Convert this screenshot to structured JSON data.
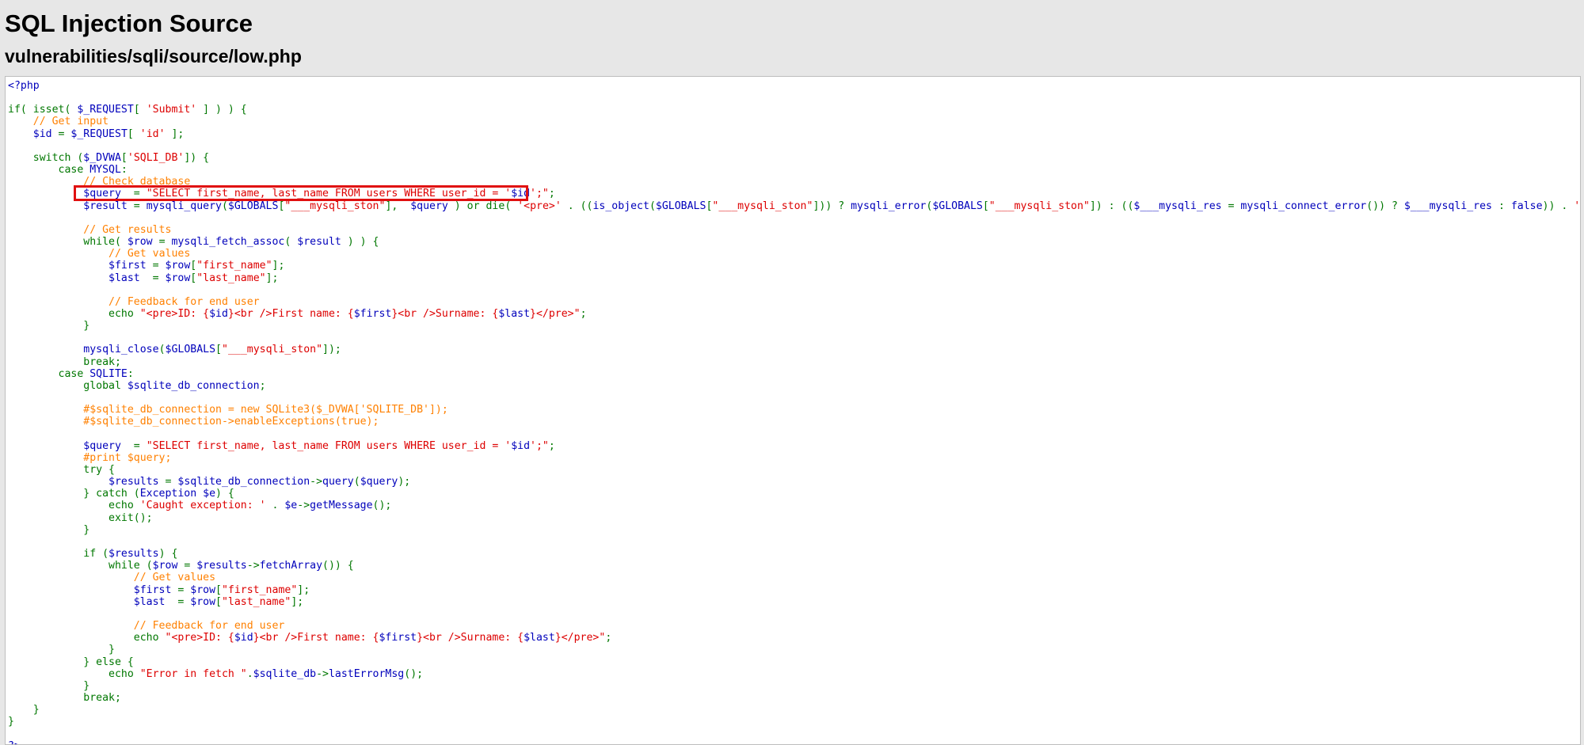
{
  "page": {
    "title": "SQL Injection Source",
    "file_path": "vulnerabilities/sqli/source/low.php"
  },
  "highlight": {
    "color": "#e01010",
    "target_line": 10
  },
  "colors": {
    "keyword": "#007700",
    "string": "#dd0000",
    "comment": "#ff8000",
    "default": "#0000bb"
  },
  "code_lines": [
    [
      [
        "v",
        "<?php"
      ]
    ],
    [],
    [
      [
        "k",
        "if( isset( "
      ],
      [
        "v",
        "$_REQUEST"
      ],
      [
        "k",
        "[ "
      ],
      [
        "s",
        "'Submit'"
      ],
      [
        "k",
        " ] ) ) {"
      ]
    ],
    [
      [
        "k",
        "    "
      ],
      [
        "c",
        "// Get input"
      ]
    ],
    [
      [
        "k",
        "    "
      ],
      [
        "v",
        "$id"
      ],
      [
        "k",
        " = "
      ],
      [
        "v",
        "$_REQUEST"
      ],
      [
        "k",
        "[ "
      ],
      [
        "s",
        "'id'"
      ],
      [
        "k",
        " ];"
      ]
    ],
    [],
    [
      [
        "k",
        "    switch ("
      ],
      [
        "v",
        "$_DVWA"
      ],
      [
        "k",
        "["
      ],
      [
        "s",
        "'SQLI_DB'"
      ],
      [
        "k",
        "]) {"
      ]
    ],
    [
      [
        "k",
        "        case "
      ],
      [
        "v",
        "MYSQL"
      ],
      [
        "k",
        ":"
      ]
    ],
    [
      [
        "k",
        "            "
      ],
      [
        "c",
        "// Check database"
      ]
    ],
    [
      [
        "k",
        "            "
      ],
      [
        "v",
        "$query"
      ],
      [
        "k",
        "  = "
      ],
      [
        "s",
        "\"SELECT first_name, last_name FROM users WHERE user_id = '"
      ],
      [
        "v",
        "$id"
      ],
      [
        "s",
        "';\""
      ],
      [
        "k",
        ";"
      ]
    ],
    [
      [
        "k",
        "            "
      ],
      [
        "v",
        "$result"
      ],
      [
        "k",
        " = "
      ],
      [
        "v",
        "mysqli_query"
      ],
      [
        "k",
        "("
      ],
      [
        "v",
        "$GLOBALS"
      ],
      [
        "k",
        "["
      ],
      [
        "s",
        "\"___mysqli_ston\""
      ],
      [
        "k",
        "],  "
      ],
      [
        "v",
        "$query"
      ],
      [
        "k",
        " ) or die( "
      ],
      [
        "s",
        "'<pre>'"
      ],
      [
        "k",
        " . (("
      ],
      [
        "v",
        "is_object"
      ],
      [
        "k",
        "("
      ],
      [
        "v",
        "$GLOBALS"
      ],
      [
        "k",
        "["
      ],
      [
        "s",
        "\"___mysqli_ston\""
      ],
      [
        "k",
        "])) ? "
      ],
      [
        "v",
        "mysqli_error"
      ],
      [
        "k",
        "("
      ],
      [
        "v",
        "$GLOBALS"
      ],
      [
        "k",
        "["
      ],
      [
        "s",
        "\"___mysqli_ston\""
      ],
      [
        "k",
        "]) : (("
      ],
      [
        "v",
        "$___mysqli_res"
      ],
      [
        "k",
        " = "
      ],
      [
        "v",
        "mysqli_connect_error"
      ],
      [
        "k",
        "()) ? "
      ],
      [
        "v",
        "$___mysqli_res"
      ],
      [
        "k",
        " : "
      ],
      [
        "v",
        "false"
      ],
      [
        "k",
        ")) . "
      ],
      [
        "s",
        "'</pre>'"
      ],
      [
        "k",
        " );"
      ]
    ],
    [],
    [
      [
        "k",
        "            "
      ],
      [
        "c",
        "// Get results"
      ]
    ],
    [
      [
        "k",
        "            while( "
      ],
      [
        "v",
        "$row"
      ],
      [
        "k",
        " = "
      ],
      [
        "v",
        "mysqli_fetch_assoc"
      ],
      [
        "k",
        "( "
      ],
      [
        "v",
        "$result"
      ],
      [
        "k",
        " ) ) {"
      ]
    ],
    [
      [
        "k",
        "                "
      ],
      [
        "c",
        "// Get values"
      ]
    ],
    [
      [
        "k",
        "                "
      ],
      [
        "v",
        "$first"
      ],
      [
        "k",
        " = "
      ],
      [
        "v",
        "$row"
      ],
      [
        "k",
        "["
      ],
      [
        "s",
        "\"first_name\""
      ],
      [
        "k",
        "];"
      ]
    ],
    [
      [
        "k",
        "                "
      ],
      [
        "v",
        "$last"
      ],
      [
        "k",
        "  = "
      ],
      [
        "v",
        "$row"
      ],
      [
        "k",
        "["
      ],
      [
        "s",
        "\"last_name\""
      ],
      [
        "k",
        "];"
      ]
    ],
    [],
    [
      [
        "k",
        "                "
      ],
      [
        "c",
        "// Feedback for end user"
      ]
    ],
    [
      [
        "k",
        "                echo "
      ],
      [
        "s",
        "\"<pre>ID: {"
      ],
      [
        "v",
        "$id"
      ],
      [
        "s",
        "}<br />First name: {"
      ],
      [
        "v",
        "$first"
      ],
      [
        "s",
        "}<br />Surname: {"
      ],
      [
        "v",
        "$last"
      ],
      [
        "s",
        "}</pre>\""
      ],
      [
        "k",
        ";"
      ]
    ],
    [
      [
        "k",
        "            }"
      ]
    ],
    [],
    [
      [
        "k",
        "            "
      ],
      [
        "v",
        "mysqli_close"
      ],
      [
        "k",
        "("
      ],
      [
        "v",
        "$GLOBALS"
      ],
      [
        "k",
        "["
      ],
      [
        "s",
        "\"___mysqli_ston\""
      ],
      [
        "k",
        "]);"
      ]
    ],
    [
      [
        "k",
        "            break;"
      ]
    ],
    [
      [
        "k",
        "        case "
      ],
      [
        "v",
        "SQLITE"
      ],
      [
        "k",
        ":"
      ]
    ],
    [
      [
        "k",
        "            global "
      ],
      [
        "v",
        "$sqlite_db_connection"
      ],
      [
        "k",
        ";"
      ]
    ],
    [],
    [
      [
        "k",
        "            "
      ],
      [
        "c",
        "#$sqlite_db_connection = new SQLite3($_DVWA['SQLITE_DB']);"
      ]
    ],
    [
      [
        "k",
        "            "
      ],
      [
        "c",
        "#$sqlite_db_connection->enableExceptions(true);"
      ]
    ],
    [],
    [
      [
        "k",
        "            "
      ],
      [
        "v",
        "$query"
      ],
      [
        "k",
        "  = "
      ],
      [
        "s",
        "\"SELECT first_name, last_name FROM users WHERE user_id = '"
      ],
      [
        "v",
        "$id"
      ],
      [
        "s",
        "';\""
      ],
      [
        "k",
        ";"
      ]
    ],
    [
      [
        "k",
        "            "
      ],
      [
        "c",
        "#print $query;"
      ]
    ],
    [
      [
        "k",
        "            try {"
      ]
    ],
    [
      [
        "k",
        "                "
      ],
      [
        "v",
        "$results"
      ],
      [
        "k",
        " = "
      ],
      [
        "v",
        "$sqlite_db_connection"
      ],
      [
        "k",
        "->"
      ],
      [
        "v",
        "query"
      ],
      [
        "k",
        "("
      ],
      [
        "v",
        "$query"
      ],
      [
        "k",
        ");"
      ]
    ],
    [
      [
        "k",
        "            } catch ("
      ],
      [
        "v",
        "Exception $e"
      ],
      [
        "k",
        ") {"
      ]
    ],
    [
      [
        "k",
        "                echo "
      ],
      [
        "s",
        "'Caught exception: '"
      ],
      [
        "k",
        " . "
      ],
      [
        "v",
        "$e"
      ],
      [
        "k",
        "->"
      ],
      [
        "v",
        "getMessage"
      ],
      [
        "k",
        "();"
      ]
    ],
    [
      [
        "k",
        "                exit();"
      ]
    ],
    [
      [
        "k",
        "            }"
      ]
    ],
    [],
    [
      [
        "k",
        "            if ("
      ],
      [
        "v",
        "$results"
      ],
      [
        "k",
        ") {"
      ]
    ],
    [
      [
        "k",
        "                while ("
      ],
      [
        "v",
        "$row"
      ],
      [
        "k",
        " = "
      ],
      [
        "v",
        "$results"
      ],
      [
        "k",
        "->"
      ],
      [
        "v",
        "fetchArray"
      ],
      [
        "k",
        "()) {"
      ]
    ],
    [
      [
        "k",
        "                    "
      ],
      [
        "c",
        "// Get values"
      ]
    ],
    [
      [
        "k",
        "                    "
      ],
      [
        "v",
        "$first"
      ],
      [
        "k",
        " = "
      ],
      [
        "v",
        "$row"
      ],
      [
        "k",
        "["
      ],
      [
        "s",
        "\"first_name\""
      ],
      [
        "k",
        "];"
      ]
    ],
    [
      [
        "k",
        "                    "
      ],
      [
        "v",
        "$last"
      ],
      [
        "k",
        "  = "
      ],
      [
        "v",
        "$row"
      ],
      [
        "k",
        "["
      ],
      [
        "s",
        "\"last_name\""
      ],
      [
        "k",
        "];"
      ]
    ],
    [],
    [
      [
        "k",
        "                    "
      ],
      [
        "c",
        "// Feedback for end user"
      ]
    ],
    [
      [
        "k",
        "                    echo "
      ],
      [
        "s",
        "\"<pre>ID: {"
      ],
      [
        "v",
        "$id"
      ],
      [
        "s",
        "}<br />First name: {"
      ],
      [
        "v",
        "$first"
      ],
      [
        "s",
        "}<br />Surname: {"
      ],
      [
        "v",
        "$last"
      ],
      [
        "s",
        "}</pre>\""
      ],
      [
        "k",
        ";"
      ]
    ],
    [
      [
        "k",
        "                }"
      ]
    ],
    [
      [
        "k",
        "            } else {"
      ]
    ],
    [
      [
        "k",
        "                echo "
      ],
      [
        "s",
        "\"Error in fetch \""
      ],
      [
        "k",
        "."
      ],
      [
        "v",
        "$sqlite_db"
      ],
      [
        "k",
        "->"
      ],
      [
        "v",
        "lastErrorMsg"
      ],
      [
        "k",
        "();"
      ]
    ],
    [
      [
        "k",
        "            }"
      ]
    ],
    [
      [
        "k",
        "            break;"
      ]
    ],
    [
      [
        "k",
        "    }"
      ]
    ],
    [
      [
        "k",
        "}"
      ]
    ],
    [],
    [
      [
        "v",
        "?>"
      ]
    ]
  ]
}
